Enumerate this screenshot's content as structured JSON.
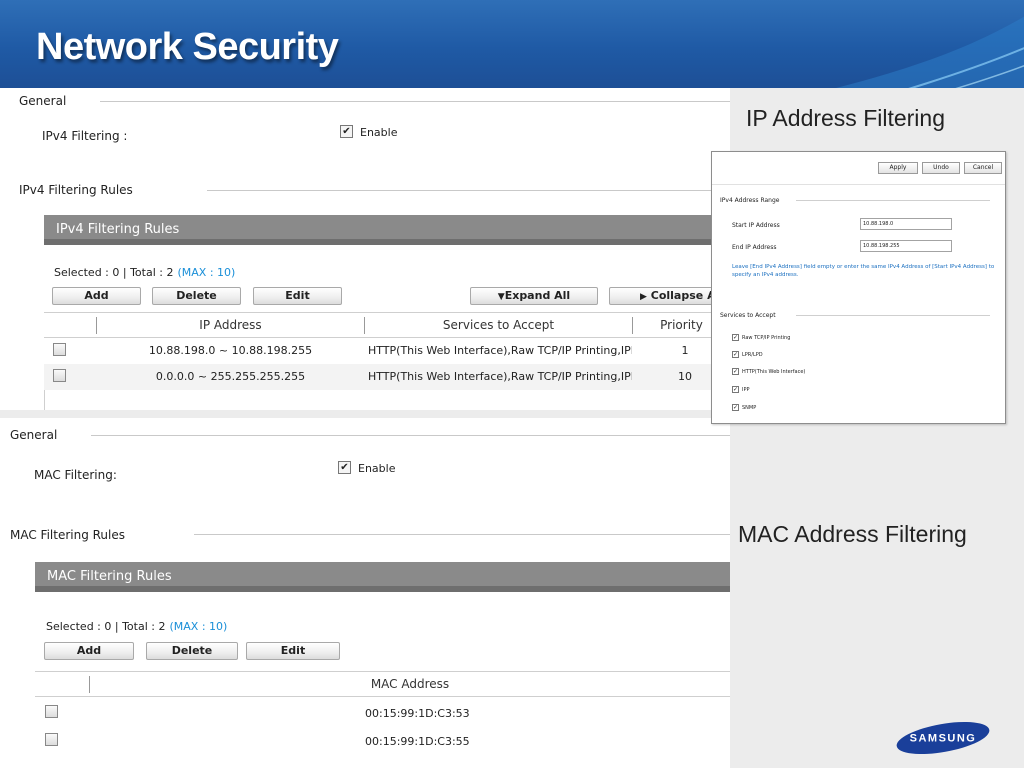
{
  "header": {
    "title": "Network Security"
  },
  "ip_panel": {
    "general_label": "General",
    "ipv4_filtering_label": "IPv4 Filtering :",
    "enable_label": "Enable",
    "rules_section_label": "IPv4 Filtering Rules",
    "grid_title": "IPv4 Filtering Rules",
    "selected_text": "Selected : 0 | Total : 2",
    "max_text": "(MAX : 10)",
    "buttons": {
      "add": "Add",
      "delete": "Delete",
      "edit": "Edit",
      "expand_all": "Expand All",
      "collapse_all": "Collapse A"
    },
    "columns": {
      "ip": "IP Address",
      "services": "Services to Accept",
      "priority": "Priority"
    },
    "rows": [
      {
        "ip": "10.88.198.0 ~ 10.88.198.255",
        "services": "HTTP(This Web Interface),Raw TCP/IP Printing,IPP,L",
        "priority": "1"
      },
      {
        "ip": "0.0.0.0 ~ 255.255.255.255",
        "services": "HTTP(This Web Interface),Raw TCP/IP Printing,IPP,L",
        "priority": "10"
      }
    ]
  },
  "mac_panel": {
    "general_label": "General",
    "mac_filtering_label": "MAC Filtering:",
    "enable_label": "Enable",
    "rules_section_label": "MAC Filtering Rules",
    "grid_title": "MAC Filtering Rules",
    "selected_text": "Selected : 0 | Total : 2",
    "max_text": "(MAX : 10)",
    "buttons": {
      "add": "Add",
      "delete": "Delete",
      "edit": "Edit"
    },
    "columns": {
      "mac": "MAC Address"
    },
    "rows": [
      {
        "mac": "00:15:99:1D:C3:53"
      },
      {
        "mac": "00:15:99:1D:C3:55"
      }
    ]
  },
  "captions": {
    "ip": "IP Address Filtering",
    "mac": "MAC Address Filtering"
  },
  "inset": {
    "apply": "Apply",
    "undo": "Undo",
    "cancel": "Cancel",
    "range_label": "IPv4 Address Range",
    "start_label": "Start IP Address",
    "start_value": "10.88.198.0",
    "end_label": "End IP Address",
    "end_value": "10.88.198.255",
    "note": "Leave [End IPv4 Address] field empty or enter the same IPv4 Address of [Start IPv4 Address] to specify an IPv4 address.",
    "services_label": "Services to Accept",
    "services": [
      "Raw TCP/IP Printing",
      "LPR/LPD",
      "HTTP(This Web Interface)",
      "IPP",
      "SNMP"
    ]
  },
  "logo": {
    "text": "SAMSUNG"
  },
  "colors": {
    "banner": "#2265ae",
    "grid_header": "#8a8a8a",
    "max_link": "#1a8fd8"
  }
}
